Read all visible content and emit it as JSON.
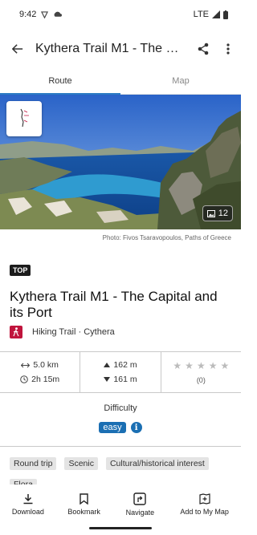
{
  "status_bar": {
    "time": "9:42",
    "network": "LTE"
  },
  "app_bar": {
    "title": "Kythera Trail M1 - The Capital and its Port"
  },
  "tabs": [
    {
      "label": "Route",
      "active": true
    },
    {
      "label": "Map",
      "active": false
    }
  ],
  "hero": {
    "photo_count": "12",
    "credit": "Photo: Fivos Tsaravopoulos, Paths of Greece"
  },
  "tour": {
    "badge": "TOP",
    "title": "Kythera Trail M1 - The Capital and its Port",
    "category": "Hiking Trail",
    "separator": "·",
    "region": "Cythera"
  },
  "stats": {
    "distance": "5.0 km",
    "duration": "2h 15m",
    "ascent": "162 m",
    "descent": "161 m",
    "rating_count": "(0)",
    "stars_filled": 0,
    "stars_total": 5
  },
  "difficulty": {
    "label": "Difficulty",
    "value": "easy",
    "color": "#1b6fb3"
  },
  "tags": [
    "Round trip",
    "Scenic",
    "Cultural/historical interest"
  ],
  "tag_partial": "Flora",
  "bottom_nav": [
    {
      "label": "Download",
      "icon": "download-icon"
    },
    {
      "label": "Bookmark",
      "icon": "bookmark-icon"
    },
    {
      "label": "Navigate",
      "icon": "navigate-icon"
    },
    {
      "label": "Add to My Map",
      "icon": "add-map-icon"
    }
  ],
  "colors": {
    "accent": "#2c7cc4",
    "hiking_red": "#c0143c",
    "badge_dark": "#1c1c1c"
  }
}
